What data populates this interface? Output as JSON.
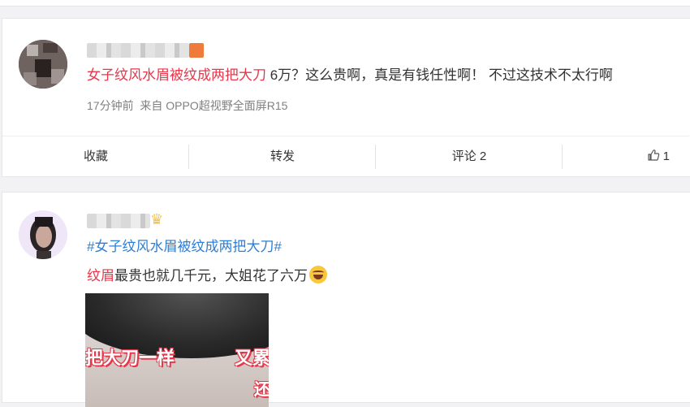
{
  "post1": {
    "topic_link": "女子纹风水眉被纹成两把大刀",
    "text": " 6万？这么贵啊，真是有钱任性啊！ 不过这技术不太行啊",
    "time": "17分钟前",
    "source": "来自 OPPO超视野全面屏R15",
    "actions": {
      "favorite": "收藏",
      "repost": "转发",
      "comment": "评论 2",
      "like": "1"
    }
  },
  "post2": {
    "topic": "#女子纹风水眉被纹成两把大刀#",
    "keyword": "纹眉",
    "text": "最贵也就几千元，大姐花了六万",
    "image_text": [
      "把大刀一样",
      "又累",
      "还"
    ]
  },
  "colors": {
    "accent_red": "#e6374b",
    "link_blue": "#2e7fd6",
    "meta_gray": "#808080"
  },
  "icons": [
    "thumbs-up-icon",
    "laugh-emoji-icon",
    "crown-icon"
  ]
}
